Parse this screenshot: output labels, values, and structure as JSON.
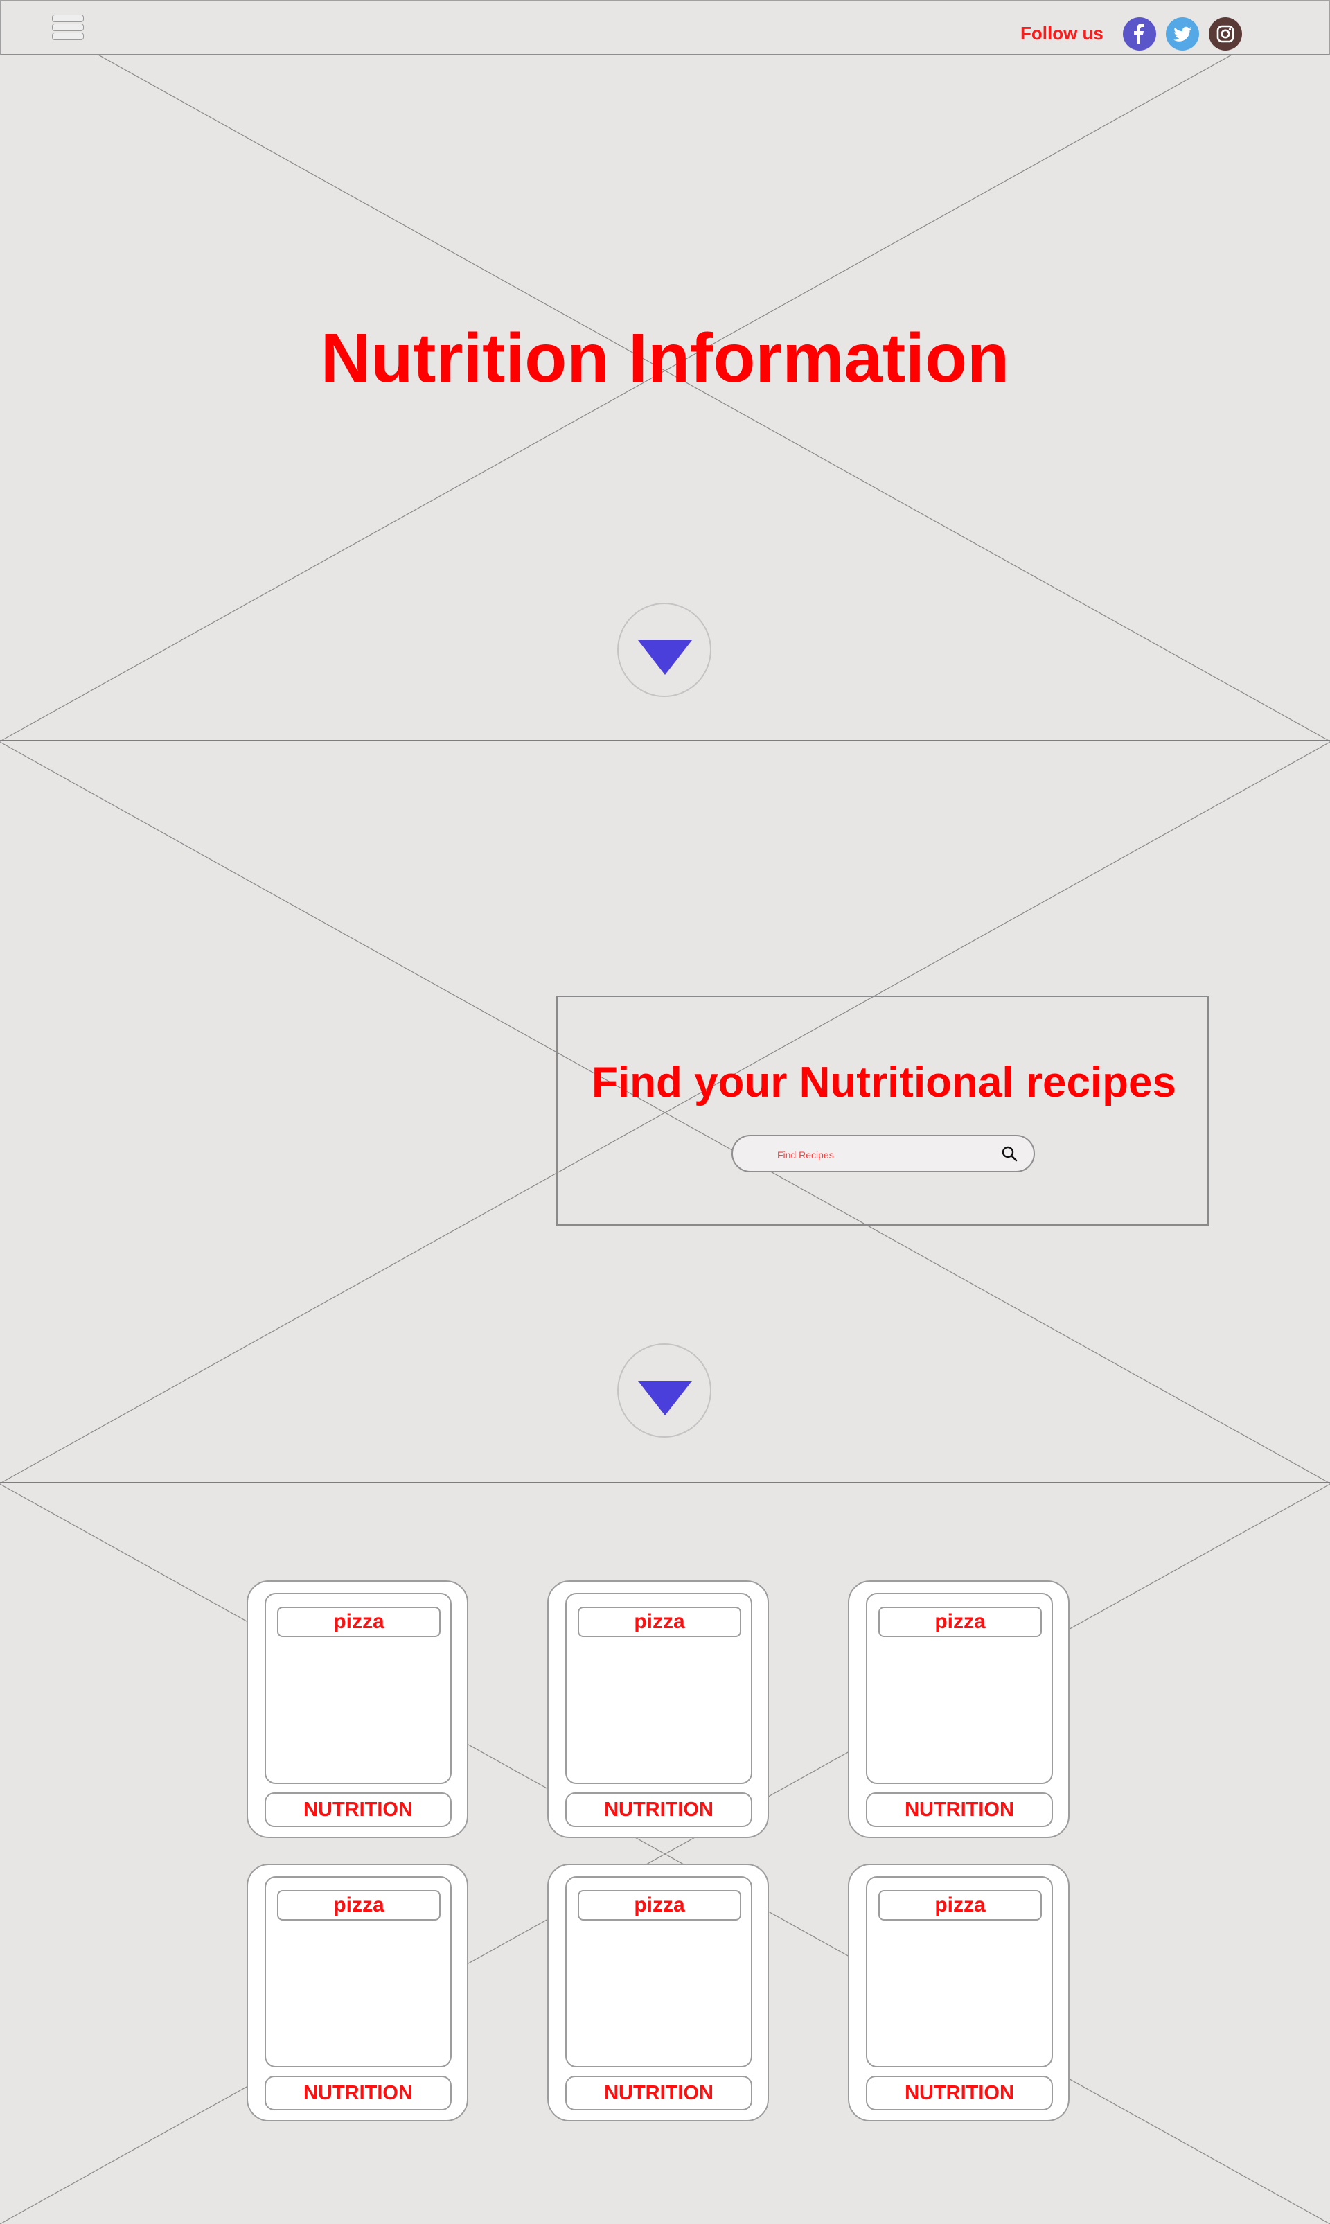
{
  "header": {
    "follow_label": "Follow us",
    "social": [
      {
        "name": "facebook",
        "icon": "facebook-icon",
        "color": "#5a55c9"
      },
      {
        "name": "twitter",
        "icon": "twitter-icon",
        "color": "#55a8e6"
      },
      {
        "name": "instagram",
        "icon": "instagram-icon",
        "color": "#5a3a36"
      }
    ]
  },
  "hero": {
    "title": "Nutrition Information",
    "scroll_icon": "chevron-down-icon",
    "accent": "#4b3fdc"
  },
  "finder": {
    "title": "Find your Nutritional recipes",
    "search_placeholder": "Find Recipes",
    "search_icon": "search-icon"
  },
  "cards": [
    {
      "label": "pizza",
      "button": "NUTRITION"
    },
    {
      "label": "pizza",
      "button": "NUTRITION"
    },
    {
      "label": "pizza",
      "button": "NUTRITION"
    },
    {
      "label": "pizza",
      "button": "NUTRITION"
    },
    {
      "label": "pizza",
      "button": "NUTRITION"
    },
    {
      "label": "pizza",
      "button": "NUTRITION"
    }
  ],
  "colors": {
    "text_accent": "#ff0000",
    "background": "#e8e6e5"
  }
}
